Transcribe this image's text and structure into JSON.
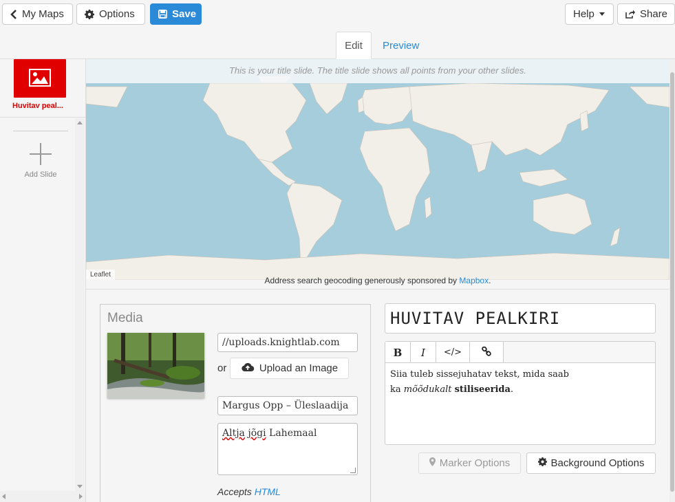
{
  "toolbar": {
    "my_maps_label": "My Maps",
    "options_label": "Options",
    "save_label": "Save",
    "help_label": "Help",
    "share_label": "Share"
  },
  "tabs": [
    {
      "label": "Edit",
      "active": true
    },
    {
      "label": "Preview",
      "active": false
    }
  ],
  "sidebar": {
    "slides": [
      {
        "label": "Huvitav peal..."
      }
    ],
    "add_slide_label": "Add Slide"
  },
  "map": {
    "title_slide_notice": "This is your title slide. The title slide shows all points from your other slides.",
    "attribution": "Leaflet",
    "geocode_text": "Address search geocoding generously sponsored by",
    "geocode_link": "Mapbox",
    "geocode_suffix": "."
  },
  "media": {
    "heading": "Media",
    "url_value": "//uploads.knightlab.com",
    "or_label": "or",
    "upload_label": "Upload an Image",
    "credit_value": "Margus Opp – Üleslaadija",
    "caption_word1": "Altja",
    "caption_word2": "jõgi",
    "caption_word3": "Lahemaal",
    "accepts_label": "Accepts",
    "accepts_link": "HTML"
  },
  "text": {
    "headline": "HUVITAV PEALKIRI",
    "toolbar": {
      "bold": "B",
      "italic": "I",
      "code": "</>"
    },
    "body_line1": "Siia tuleb sissejuhatav tekst, mida saab",
    "body_line2_prefix": "ka ",
    "body_line2_italic": "mõõdukalt",
    "body_line2_bold": "stiliseerida",
    "body_line2_suffix": "."
  },
  "buttons": {
    "marker_options": "Marker Options",
    "background_options": "Background Options"
  },
  "colors": {
    "accent": "#2a8ad8",
    "slide_thumb": "#e10000",
    "ocean": "#a6cddb",
    "land": "#f2efe9"
  }
}
